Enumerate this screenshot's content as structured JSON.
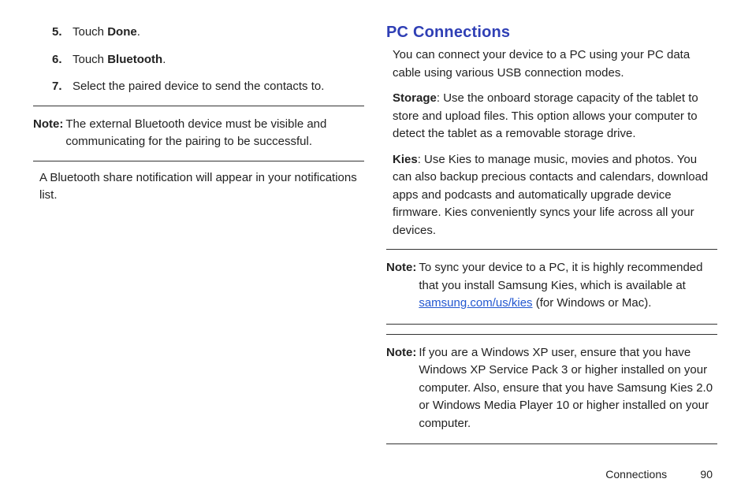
{
  "leftCol": {
    "steps": [
      {
        "num": "5.",
        "prefix": "Touch ",
        "bold": "Done",
        "suffix": "."
      },
      {
        "num": "6.",
        "prefix": "Touch ",
        "bold": "Bluetooth",
        "suffix": "."
      },
      {
        "num": "7.",
        "text": "Select the paired device to send the contacts to."
      }
    ],
    "note1": {
      "label": "Note:",
      "body": "The external Bluetooth device must be visible and communicating for the pairing to be successful."
    },
    "after": "A Bluetooth share notification will appear in your notifications list."
  },
  "rightCol": {
    "header": "PC Connections",
    "intro": "You can connect your device to a PC using your PC data cable using various USB connection modes.",
    "storage": {
      "label": "Storage",
      "body": ": Use the onboard storage capacity of the tablet to store and upload files. This option allows your computer to detect the tablet as a removable storage drive."
    },
    "kies": {
      "label": "Kies",
      "body": ": Use Kies to manage music, movies and photos. You can also backup precious contacts and calendars, download apps and podcasts and automatically upgrade device firmware. Kies conveniently syncs your life across all your devices."
    },
    "note2": {
      "label": "Note:",
      "pre": "To sync your device to a PC, it is highly recommended that you install Samsung Kies, which is available at ",
      "link": "samsung.com/us/kies",
      "post": " (for Windows or Mac)."
    },
    "note3": {
      "label": "Note:",
      "body": "If you are a Windows XP user, ensure that you have Windows XP Service Pack 3 or higher installed on your computer. Also, ensure that you have Samsung Kies 2.0 or Windows Media Player 10 or higher installed on your computer."
    }
  },
  "footer": {
    "section": "Connections",
    "page": "90"
  }
}
